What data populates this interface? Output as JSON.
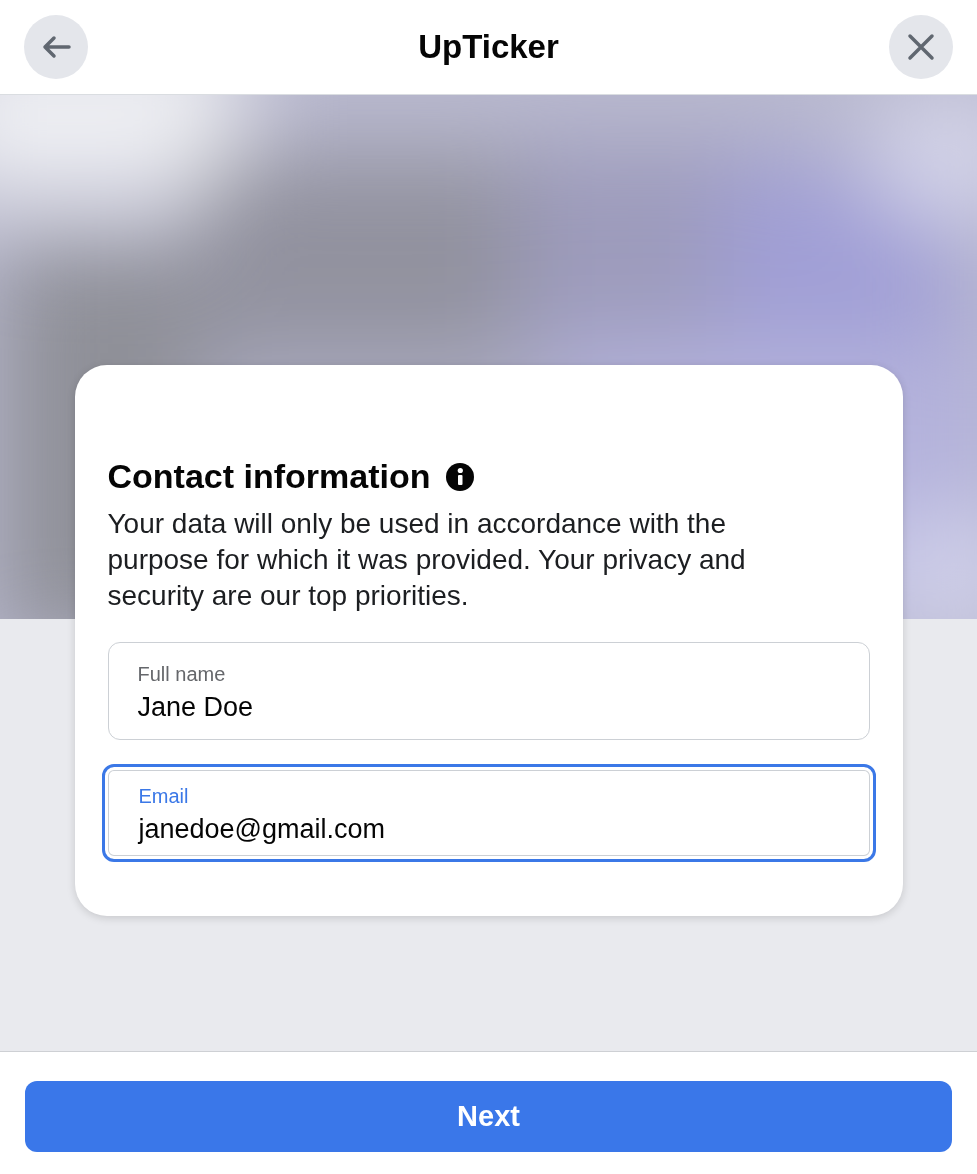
{
  "header": {
    "title": "UpTicker"
  },
  "card": {
    "title": "Contact information",
    "description": "Your data will only be used in accordance with the purpose for which it was provided. Your privacy and security are our top priorities."
  },
  "fields": [
    {
      "label": "Full name",
      "value": "Jane Doe",
      "focused": false
    },
    {
      "label": "Email",
      "value": "janedoe@gmail.com",
      "focused": true
    }
  ],
  "next_button": {
    "label": "Next"
  }
}
